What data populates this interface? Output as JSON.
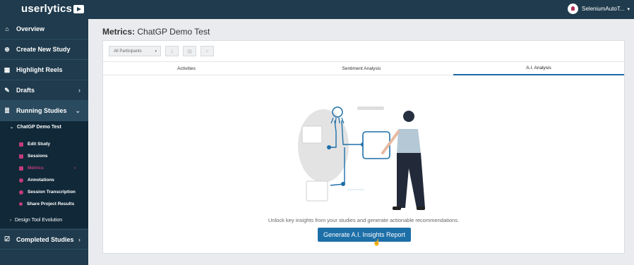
{
  "app": {
    "logo_text": "userlytics",
    "logo_icon": "play-icon",
    "user_name": "SeleniumAutoT...",
    "user_caret": "▾"
  },
  "sidebar": {
    "items": [
      {
        "label": "Overview",
        "icon": "home-icon",
        "glyph": "⌂"
      },
      {
        "label": "Create New Study",
        "icon": "plus-circle-icon",
        "glyph": "⊕"
      },
      {
        "label": "Highlight Reels",
        "icon": "film-icon",
        "glyph": "▦"
      },
      {
        "label": "Drafts",
        "icon": "edit-icon",
        "glyph": "✎",
        "chevron": "›"
      },
      {
        "label": "Running Studies",
        "icon": "list-icon",
        "glyph": "≣",
        "chevron": "⌄"
      },
      {
        "label": "Completed Studies",
        "icon": "check-square-icon",
        "glyph": "☑",
        "chevron": "›"
      }
    ],
    "study": {
      "name": "ChatGP Demo Test",
      "chevron": "⌄",
      "subitems": [
        {
          "label": "Edit Study",
          "icon": "pencil-icon"
        },
        {
          "label": "Sessions",
          "icon": "video-icon"
        },
        {
          "label": "Metrics",
          "icon": "bar-chart-icon",
          "active": true,
          "chevron": "›"
        },
        {
          "label": "Annotations",
          "icon": "gear-icon"
        },
        {
          "label": "Session Transcription",
          "icon": "chat-icon"
        },
        {
          "label": "Share Project Results",
          "icon": "share-icon"
        }
      ]
    },
    "other_study": {
      "name": "Design Tool Evolution",
      "chevron": "›"
    }
  },
  "main": {
    "title_prefix": "Metrics:",
    "title_name": "ChatGP Demo Test",
    "participants_select": "All Participants",
    "select_caret": "▾",
    "tabs": [
      {
        "label": "Activities"
      },
      {
        "label": "Sentiment Analysis"
      },
      {
        "label": "A.I. Analysis",
        "active": true
      }
    ],
    "description": "Unlock key insights from your studies and generate actionable recommendations.",
    "generate_button": "Generate A.I. Insights Report"
  },
  "colors": {
    "sidebar": "#1f3b4d",
    "accent": "#1d6fa8",
    "metrics_active": "#c13b7a"
  }
}
